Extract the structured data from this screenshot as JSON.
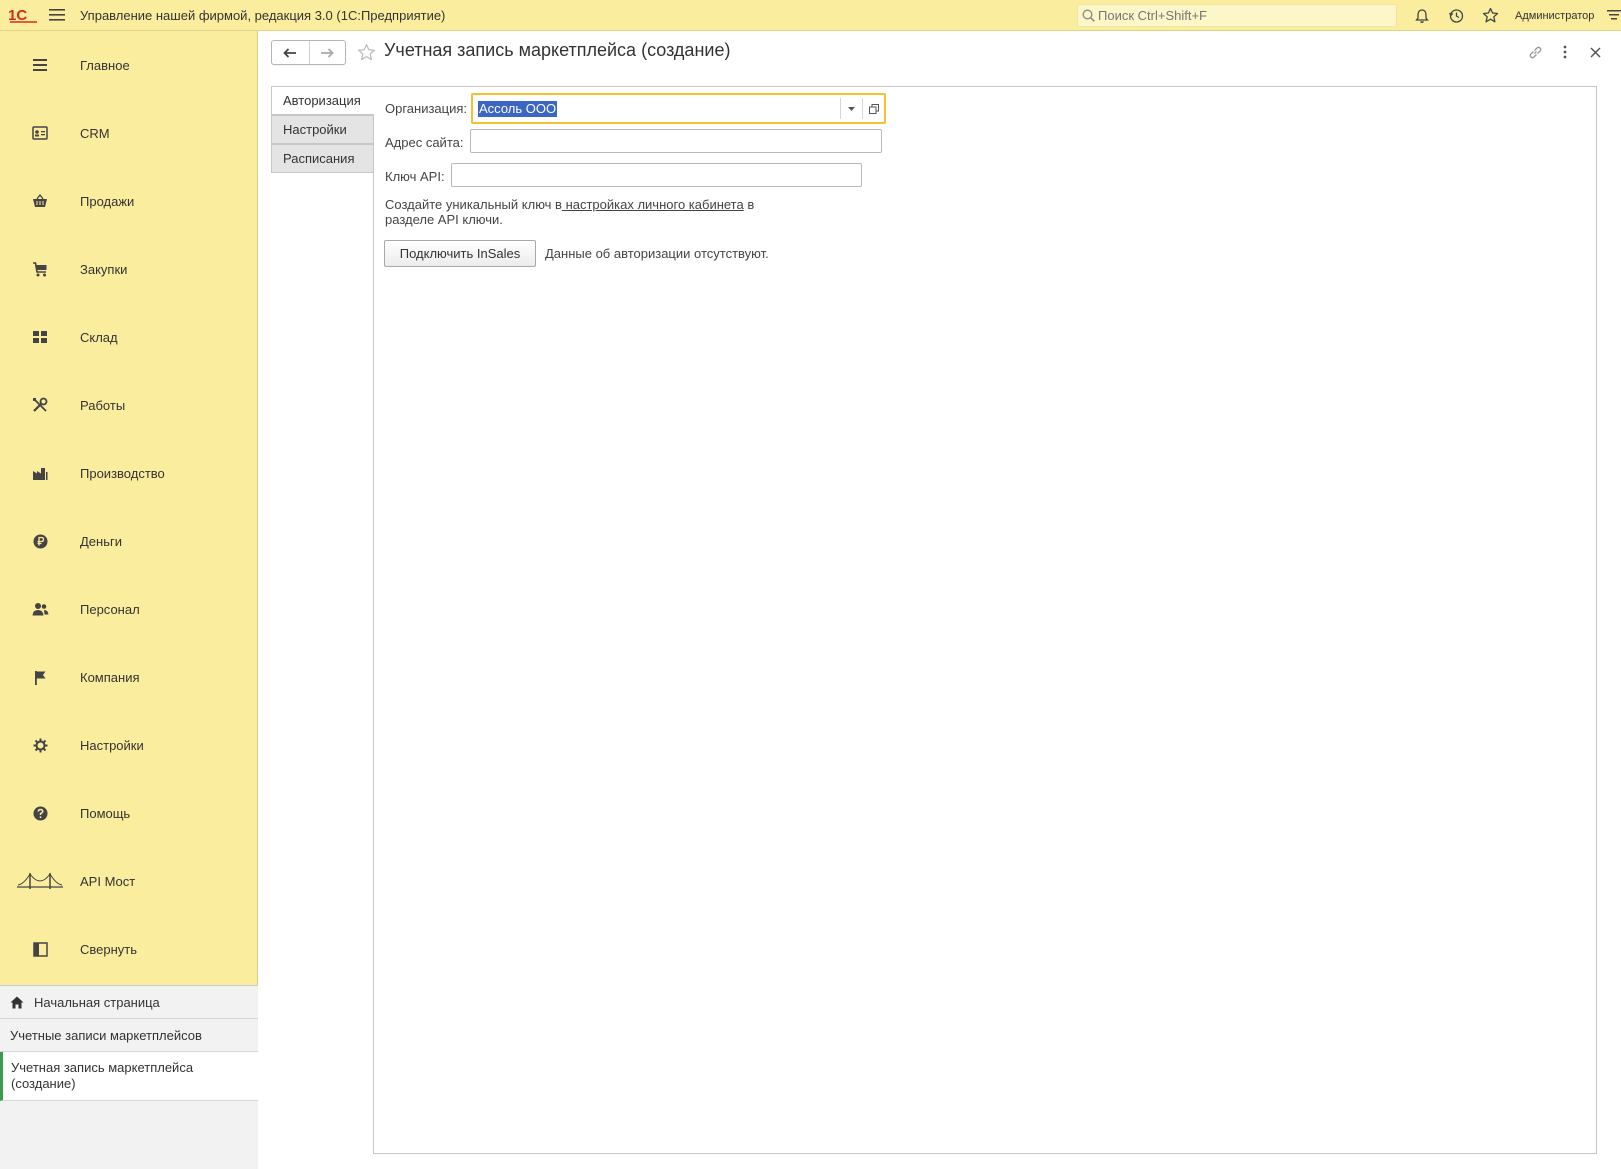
{
  "app": {
    "logo_text": "1С",
    "title": "Управление нашей фирмой, редакция 3.0  (1С:Предприятие)",
    "search_placeholder": "Поиск Ctrl+Shift+F",
    "user_name": "Администратор"
  },
  "sidebar": {
    "items": [
      {
        "label": "Главное",
        "icon": "menu-list-icon"
      },
      {
        "label": "CRM",
        "icon": "contact-card-icon"
      },
      {
        "label": "Продажи",
        "icon": "basket-icon"
      },
      {
        "label": "Закупки",
        "icon": "cart-icon"
      },
      {
        "label": "Склад",
        "icon": "warehouse-grid-icon"
      },
      {
        "label": "Работы",
        "icon": "tools-icon"
      },
      {
        "label": "Производство",
        "icon": "factory-icon"
      },
      {
        "label": "Деньги",
        "icon": "ruble-coin-icon"
      },
      {
        "label": "Персонал",
        "icon": "people-icon"
      },
      {
        "label": "Компания",
        "icon": "flag-icon"
      },
      {
        "label": "Настройки",
        "icon": "gear-icon"
      },
      {
        "label": "Помощь",
        "icon": "help-icon"
      },
      {
        "label": "API Мост",
        "icon": "bridge-icon"
      },
      {
        "label": "Свернуть",
        "icon": "collapse-panel-icon"
      }
    ],
    "open_windows": {
      "home": "Начальная страница",
      "list": "Учетные записи маркетплейсов",
      "current": "Учетная запись маркетплейса (создание)"
    }
  },
  "form": {
    "title": "Учетная запись маркетплейса (создание)",
    "tabs": [
      "Авторизация",
      "Настройки",
      "Расписания"
    ],
    "fields": {
      "org_label": "Организация:",
      "org_value": "Ассоль ООО",
      "site_label": "Адрес сайта:",
      "site_value": "",
      "api_label": "Ключ API:",
      "api_value": ""
    },
    "hint": {
      "before": "Создайте уникальный ключ в",
      "link": " настройках личного кабинета",
      "after": " в разделе API ключи."
    },
    "connect_button": "Подключить InSales",
    "auth_status": "Данные об авторизации отсутствуют."
  },
  "colors": {
    "sidebar_bg": "#fbed9e",
    "focus_border": "#f2c232",
    "selection_bg": "#3b66c4",
    "active_marker": "#3d9b4b",
    "logo_red": "#d52b1e"
  }
}
